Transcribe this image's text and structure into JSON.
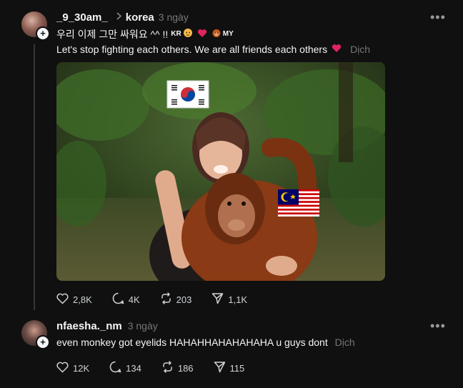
{
  "post": {
    "username": "_9_30am_",
    "topic": "korea",
    "time": "3 ngày",
    "line1": "우리 이제 그만 싸워요 ^^ !!",
    "tag_kr": "KR",
    "tag_my": "MY",
    "line2": "Let's stop fighting each others. We are all friends each others",
    "translate": "Dịch",
    "likes": "2,8K",
    "comments": "4K",
    "reposts": "203",
    "shares": "1,1K"
  },
  "reply": {
    "username": "nfaesha._nm",
    "time": "3 ngày",
    "text": "even monkey got eyelids HAHAHHAHAHAHAHA u guys dont",
    "translate": "Dịch",
    "likes": "12K",
    "comments": "134",
    "reposts": "186",
    "shares": "115"
  },
  "icons": {
    "like": "heart-icon",
    "comment": "comment-icon",
    "repost": "repost-icon",
    "share": "send-icon",
    "more": "more-icon"
  },
  "colors": {
    "background": "#101010",
    "text": "#f3f5f7",
    "muted": "#777777",
    "heart": "#e0245e"
  }
}
